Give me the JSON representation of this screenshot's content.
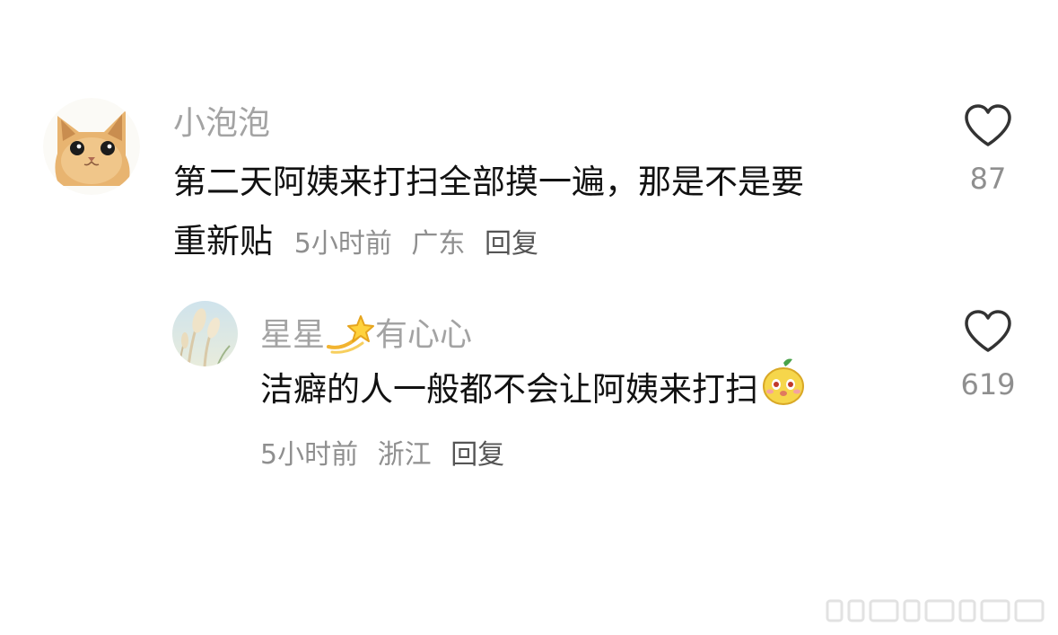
{
  "comments": [
    {
      "username": "小泡泡",
      "text_line1": "第二天阿姨来打扫全部摸一遍，那是不是要",
      "text_line2": "重新贴",
      "time": "5小时前",
      "location": "广东",
      "reply_label": "回复",
      "likes": "87",
      "avatar_icon": "cat-avatar"
    }
  ],
  "replies": [
    {
      "username_part1": "星星",
      "username_part2": "有心心",
      "username_emoji": "dizzy-star-emoji",
      "text": "洁癖的人一般都不会让阿姨来打扫",
      "text_emoji": "cute-pear-emoji",
      "time": "5小时前",
      "location": "浙江",
      "reply_label": "回复",
      "likes": "619",
      "avatar_icon": "reed-grass-avatar"
    }
  ],
  "colors": {
    "username": "#a3a3a3",
    "meta": "#8f8f8f",
    "text": "#111111",
    "like_icon": "#333333"
  }
}
